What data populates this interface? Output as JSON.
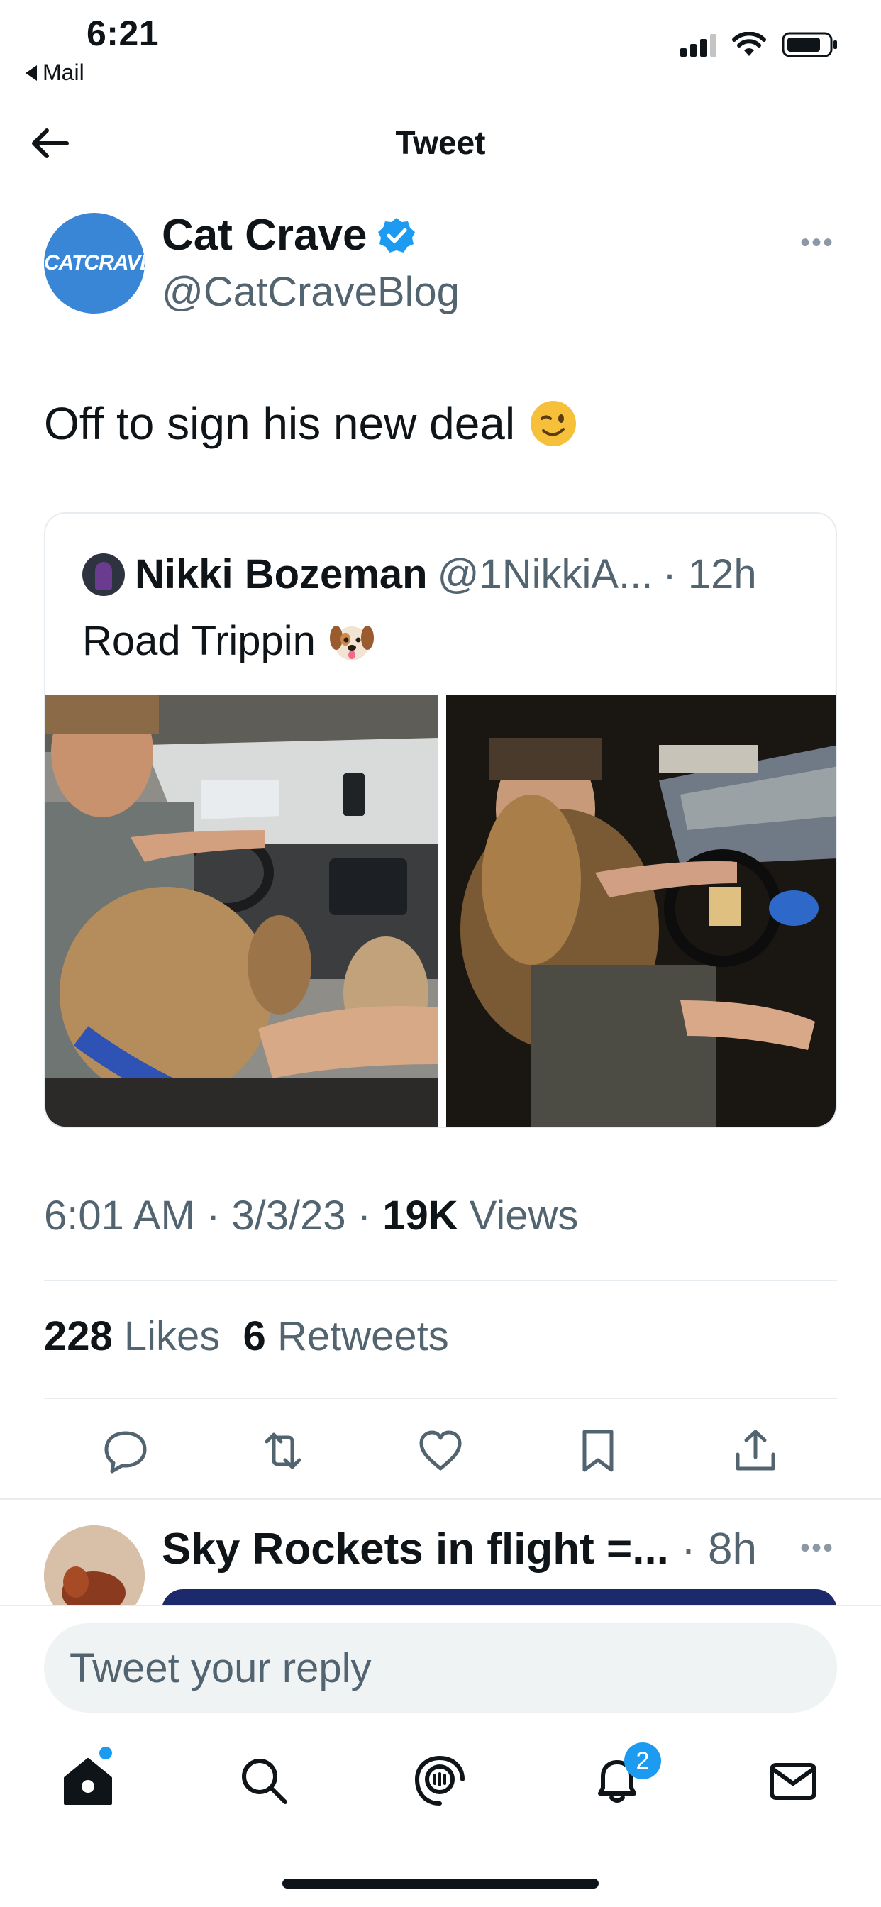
{
  "status_bar": {
    "time": "6:21",
    "back_app": "Mail"
  },
  "header": {
    "title": "Tweet"
  },
  "author": {
    "name": "Cat Crave",
    "handle": "@CatCraveBlog",
    "avatar_text": "CATCRAVE",
    "verified_icon": "verified-badge-icon",
    "brand_color": "#3a86d6"
  },
  "tweet": {
    "text": "Off to sign his new deal",
    "emoji": "winking-face-icon"
  },
  "quoted": {
    "name": "Nikki Bozeman",
    "handle": "@1NikkiA...",
    "time": "· 12h",
    "text": "Road Trippin",
    "emoji": "dog-face-icon"
  },
  "meta": {
    "time": "6:01 AM",
    "sep1": "·",
    "date": "3/3/23",
    "sep2": "·",
    "views_count": "19K",
    "views_label": "Views"
  },
  "stats": {
    "likes_count": "228",
    "likes_label": "Likes",
    "retweets_count": "6",
    "retweets_label": "Retweets"
  },
  "actions": [
    "reply-icon",
    "retweet-icon",
    "like-icon",
    "bookmark-icon",
    "share-icon"
  ],
  "reply_preview": {
    "name": "Sky Rockets in flight =...",
    "time": "· 8h"
  },
  "composer": {
    "placeholder": "Tweet your reply"
  },
  "tabbar": {
    "notifications_badge": "2"
  },
  "colors": {
    "accent": "#1d9bf0",
    "secondary_text": "#536471",
    "divider": "#e6ecf0"
  }
}
